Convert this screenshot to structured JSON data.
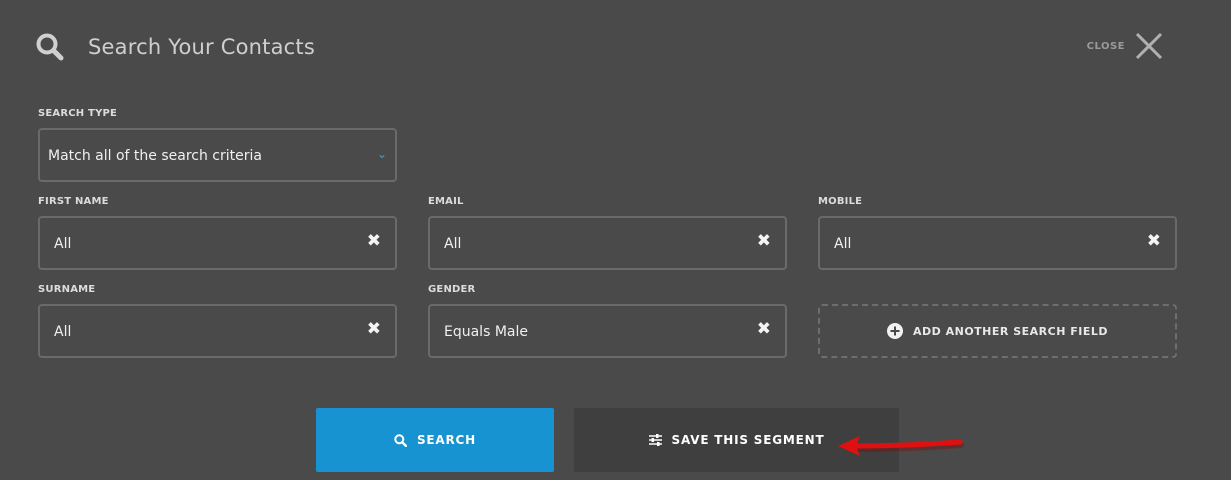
{
  "header": {
    "title": "Search Your Contacts",
    "close_label": "CLOSE"
  },
  "search_type": {
    "label": "SEARCH TYPE",
    "selected": "Match all of the search criteria"
  },
  "fields": {
    "first_name": {
      "label": "FIRST NAME",
      "value": "All"
    },
    "email": {
      "label": "EMAIL",
      "value": "All"
    },
    "mobile": {
      "label": "MOBILE",
      "value": "All"
    },
    "surname": {
      "label": "SURNAME",
      "value": "All"
    },
    "gender": {
      "label": "GENDER",
      "value": "Equals Male"
    }
  },
  "add_field_label": "ADD ANOTHER SEARCH FIELD",
  "buttons": {
    "search_label": "SEARCH",
    "save_label": "SAVE THIS SEGMENT"
  },
  "icons": {
    "search": "search-icon",
    "close": "close-icon",
    "clear": "clear-icon",
    "chevron": "chevron-down-icon",
    "add": "plus-circle-icon",
    "sliders": "sliders-icon",
    "annotation": "red-arrow-annotation"
  },
  "colors": {
    "background": "#4a4a4a",
    "primary_button": "#1793d1",
    "secondary_button": "#3f3f3f",
    "chevron": "#3aa0dd",
    "arrow": "#e01010"
  }
}
